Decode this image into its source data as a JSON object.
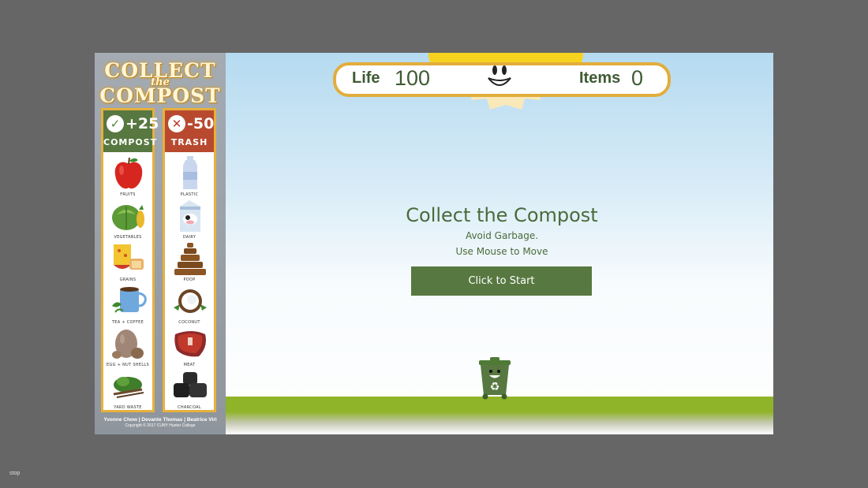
{
  "logo": {
    "line1": "COLLECT",
    "line2": "the",
    "line3": "COMPOST"
  },
  "compost": {
    "score": "+25",
    "label": "COMPOST",
    "items": [
      "FRUITS",
      "VEGETABLES",
      "GRAINS",
      "TEA + COFFEE",
      "EGG + NUT SHELLS",
      "YARD WASTE"
    ]
  },
  "trash": {
    "score": "-50",
    "label": "TRASH",
    "items": [
      "PLASTIC",
      "DAIRY",
      "POOP",
      "COCONUT",
      "MEAT",
      "CHARCOAL"
    ]
  },
  "credits": {
    "names": "Yvonne Chow | Devante Thomas | Beatrice Viri",
    "copyright": "Copyright © 2017 CUNY Hunter College"
  },
  "hud": {
    "life_label": "Life",
    "life_value": "100",
    "items_label": "Items",
    "items_value": "0"
  },
  "intro": {
    "title": "Collect the Compost",
    "line1": "Avoid Garbage.",
    "line2": "Use Mouse to Move",
    "start_label": "Click to Start"
  },
  "footer": {
    "stop": "stop"
  },
  "colors": {
    "green": "#577840",
    "red": "#b8492f",
    "gold": "#e2ad3c",
    "ground": "#8fb329"
  }
}
